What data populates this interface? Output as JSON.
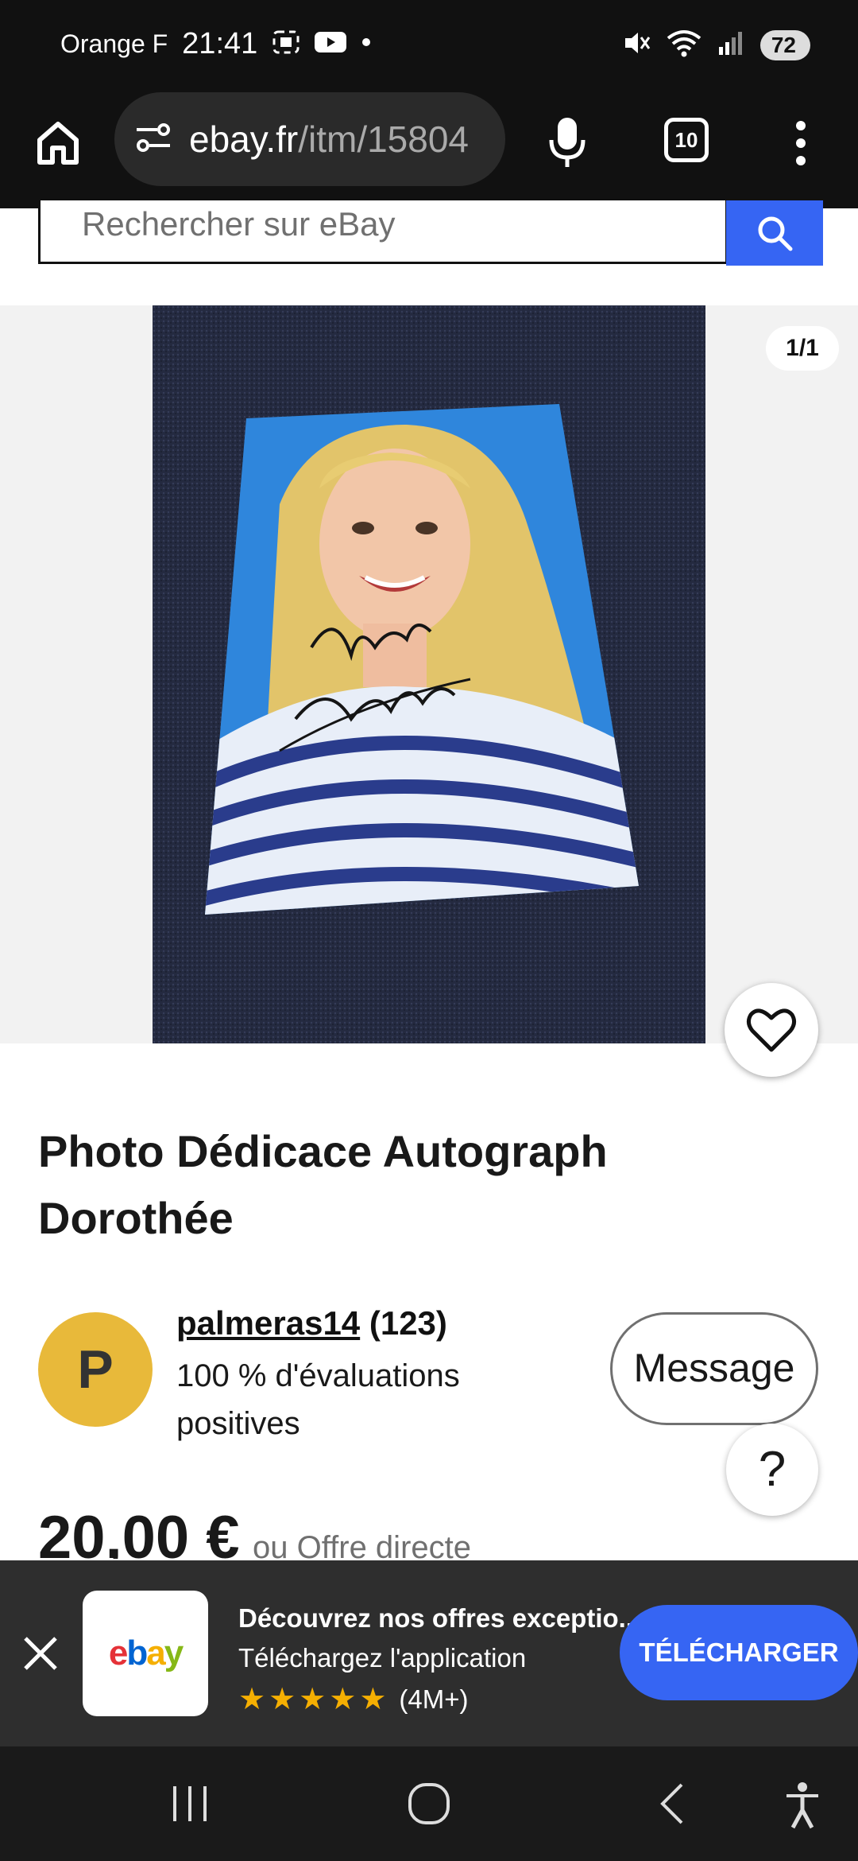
{
  "status_bar": {
    "carrier": "Orange F",
    "time": "21:41",
    "battery": "72",
    "icons": [
      "screenshot-icon",
      "youtube-icon",
      "dot-icon",
      "mute-icon",
      "wifi-icon",
      "signal-icon"
    ]
  },
  "browser": {
    "url_domain": "ebay.fr",
    "url_path": "/itm/15804",
    "tab_count": "10",
    "icons": [
      "home-icon",
      "site-settings-icon",
      "mic-icon",
      "tabs-icon",
      "more-menu-icon"
    ]
  },
  "search": {
    "placeholder": "Rechercher sur eBay",
    "icon": "search-icon"
  },
  "gallery": {
    "counter": "1/1",
    "image_description": "signed photo",
    "signature_text": "Amitiés Dorothée",
    "icons": [
      "heart-icon"
    ]
  },
  "listing": {
    "title": "Photo Dédicace Autograph Dorothée",
    "price": "20,00 €",
    "price_alt": "ou Offre directe"
  },
  "seller": {
    "initial": "P",
    "name": "palmeras14",
    "count": "(123)",
    "rating": "100 % d'évaluations positives",
    "message_label": "Message",
    "help_label": "?"
  },
  "app_banner": {
    "title": "Découvrez nos offres exceptio...",
    "subtitle": "Téléchargez l'application",
    "rating_count": "(4M+)",
    "stars": 5,
    "download_label": "TÉLÉCHARGER",
    "logo_letters": [
      "e",
      "b",
      "a",
      "y"
    ],
    "logo_colors": [
      "#e53238",
      "#0064d2",
      "#f5af02",
      "#86b817"
    ]
  },
  "colors": {
    "ebay_blue": "#3665f3",
    "avatar_yellow": "#e8b93a",
    "star_yellow": "#f5af02"
  },
  "nav_bar": {
    "icons": [
      "recent-apps-icon",
      "home-circle-icon",
      "back-icon",
      "accessibility-icon"
    ]
  }
}
